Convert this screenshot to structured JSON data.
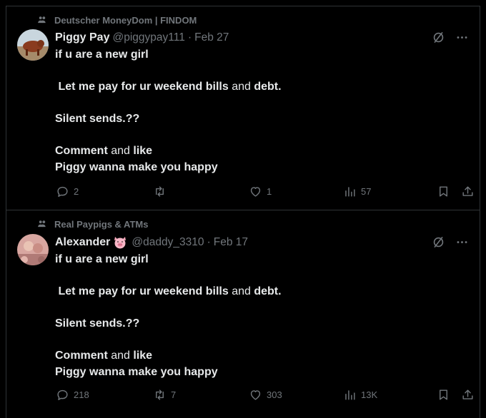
{
  "posts": [
    {
      "context": "Deutscher MoneyDom | FINDOM",
      "name": "Piggy Pay",
      "name_emoji": "",
      "handle": "@piggypay111",
      "separator": "·",
      "date": "Feb 27",
      "lines": {
        "l1": "if u are a new girl",
        "l2a": "Let me pay for ur weekend bills",
        "l2b": " and ",
        "l2c": "debt.",
        "l3": "Silent sends.??",
        "l4a": "Comment",
        "l4b": " and ",
        "l4c": "like",
        "l5": "Piggy wanna make you happy"
      },
      "stats": {
        "replies": "2",
        "reposts": "",
        "likes": "1",
        "views": "57"
      }
    },
    {
      "context": "Real Paypigs & ATMs",
      "name": "Alexander",
      "name_emoji": "pig-face-emoji",
      "handle": "@daddy_3310",
      "separator": "·",
      "date": "Feb 17",
      "lines": {
        "l1": "if u are a new girl",
        "l2a": "Let me pay for ur weekend bills",
        "l2b": " and ",
        "l2c": "debt.",
        "l3": "Silent sends.??",
        "l4a": "Comment",
        "l4b": " and ",
        "l4c": "like",
        "l5": "Piggy wanna make you happy"
      },
      "stats": {
        "replies": "218",
        "reposts": "7",
        "likes": "303",
        "views": "13K"
      }
    }
  ],
  "colors": {
    "background": "#000000",
    "text": "#e7e9ea",
    "muted": "#71767b",
    "border": "#2f3336"
  },
  "icons": [
    "community-icon",
    "grok-icon",
    "more-icon",
    "reply-icon",
    "repost-icon",
    "like-icon",
    "views-icon",
    "bookmark-icon",
    "share-icon"
  ]
}
